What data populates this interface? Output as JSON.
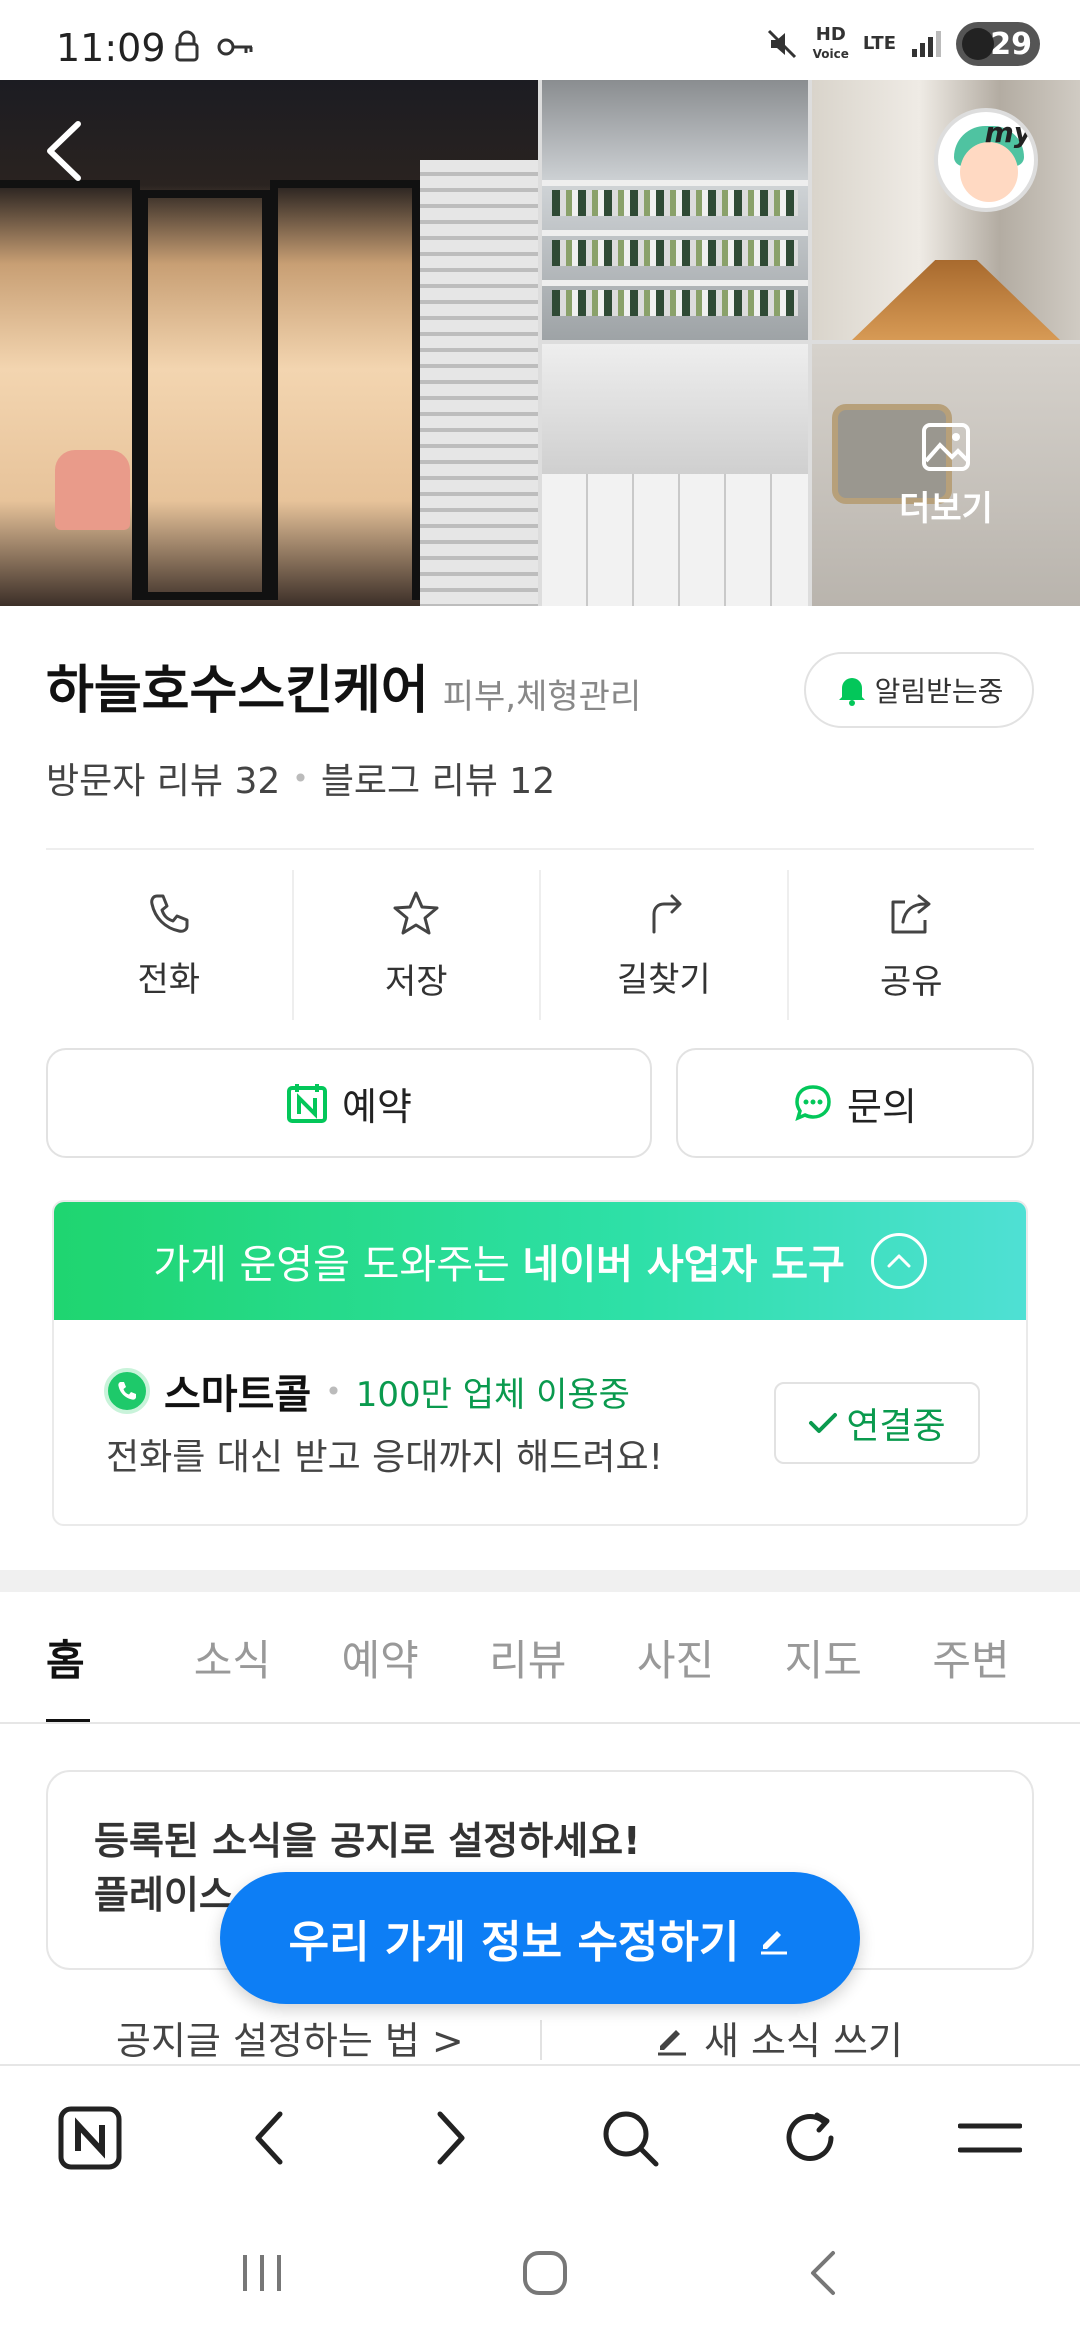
{
  "status_bar": {
    "time": "11:09",
    "hd_voice": "HD\nVoice",
    "lte": "LTE",
    "battery": "29"
  },
  "photos": {
    "more_label": "더보기",
    "my_badge": "my"
  },
  "place": {
    "name": "하늘호수스킨케어",
    "category": "피부,체형관리",
    "notify_label": "알림받는중",
    "visitor_reviews": "방문자 리뷰 32",
    "blog_reviews": "블로그 리뷰 12"
  },
  "actions": [
    {
      "label": "전화",
      "icon": "phone-icon"
    },
    {
      "label": "저장",
      "icon": "star-icon"
    },
    {
      "label": "길찾기",
      "icon": "directions-icon"
    },
    {
      "label": "공유",
      "icon": "share-icon"
    }
  ],
  "buttons": {
    "reserve": "예약",
    "inquiry": "문의"
  },
  "biz_tool": {
    "head_prefix": "가게 운영을 도와주는",
    "head_strong": "네이버 사업자 도구",
    "smartcall_name": "스마트콜",
    "smartcall_users": "100만 업체 이용중",
    "smartcall_desc": "전화를 대신 받고 응대까지 해드려요!",
    "connected_label": "연결중"
  },
  "tabs": [
    "홈",
    "소식",
    "예약",
    "리뷰",
    "사진",
    "지도",
    "주변"
  ],
  "notice": {
    "line1": "등록된 소식을 공지로 설정하세요!",
    "line2": "플레이스"
  },
  "fab": {
    "label": "우리 가게 정보 수정하기"
  },
  "links": {
    "how_to": "공지글 설정하는 법 >",
    "new_post": "새 소식 쓰기"
  },
  "colors": {
    "naver_green": "#03c75a",
    "fab_blue": "#0d7ef5"
  }
}
